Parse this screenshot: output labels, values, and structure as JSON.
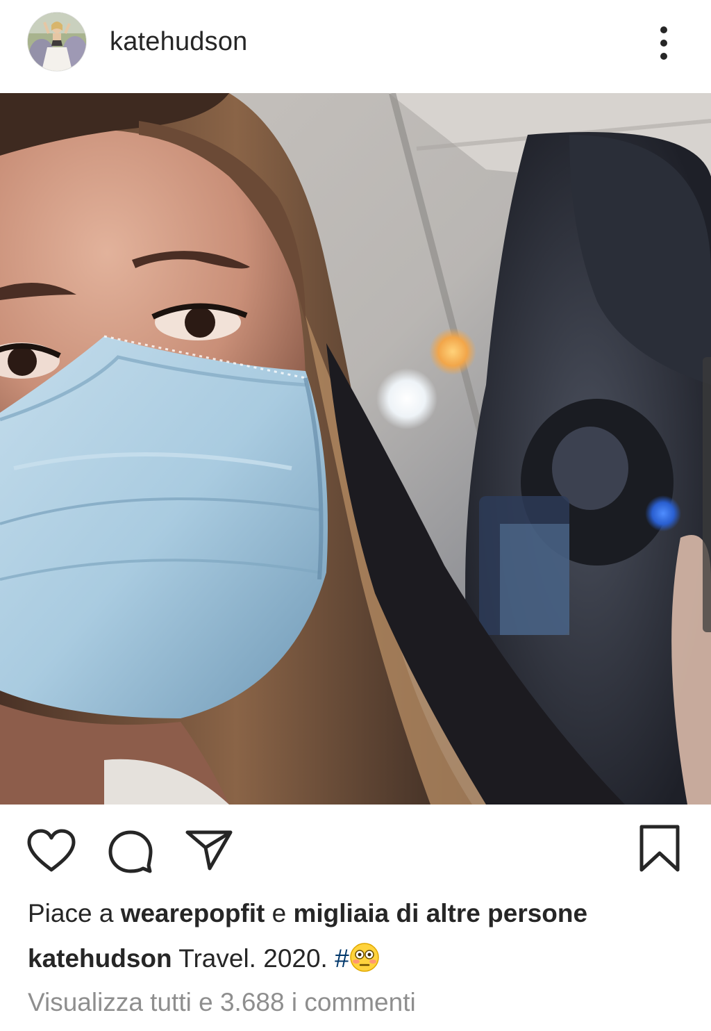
{
  "header": {
    "username": "katehudson"
  },
  "photo": {
    "description_icon": "selfie-photo"
  },
  "actions": {
    "like_icon": "heart-icon",
    "comment_icon": "comment-icon",
    "share_icon": "send-icon",
    "save_icon": "bookmark-icon"
  },
  "likes": {
    "prefix": "Piace a ",
    "liker": "wearepopfit",
    "middle": " e ",
    "others": "migliaia di altre persone"
  },
  "caption": {
    "username": "katehudson",
    "text": " Travel. 2020. ",
    "hashtag": "#",
    "emoji": "flushed-face-emoji"
  },
  "comments": {
    "view_all": "Visualizza tutti e 3.688 i commenti"
  },
  "colors": {
    "text": "#262626",
    "muted": "#8e8e8e",
    "hashtag": "#00376b",
    "mask_blue": "#a9cbe0"
  }
}
